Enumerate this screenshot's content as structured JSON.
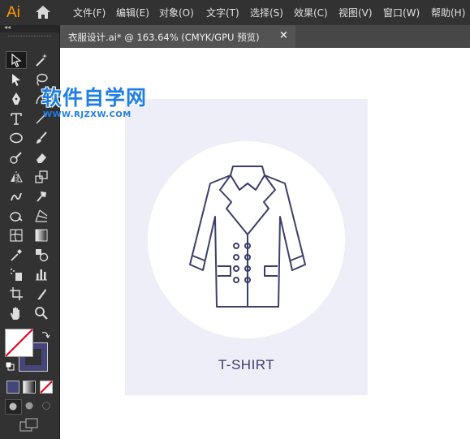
{
  "app": {
    "logo": "Ai"
  },
  "menu": {
    "items": [
      "文件(F)",
      "编辑(E)",
      "对象(O)",
      "文字(T)",
      "选择(S)",
      "效果(C)",
      "视图(V)",
      "窗口(W)",
      "帮助(H)"
    ]
  },
  "tab": {
    "title": "衣服设计.ai* @ 163.64% (CMYK/GPU 预览)",
    "close": "×"
  },
  "toolbar": {
    "collapse": "◂◂"
  },
  "tools": [
    "selection-tool",
    "magic-wand-tool",
    "direct-selection-tool",
    "lasso-tool",
    "pen-tool",
    "curvature-tool",
    "type-tool",
    "line-segment-tool",
    "ellipse-tool",
    "paintbrush-tool",
    "shaper-tool",
    "eraser-tool",
    "reflect-tool",
    "scale-tool",
    "warp-tool",
    "free-transform-tool",
    "shape-builder-tool",
    "perspective-grid-tool",
    "mesh-tool",
    "gradient-tool",
    "eyedropper-tool",
    "blend-tool",
    "symbol-sprayer-tool",
    "column-graph-tool",
    "artboard-tool",
    "slice-tool",
    "hand-tool",
    "zoom-tool"
  ],
  "artwork": {
    "label": "T-SHIRT"
  },
  "watermark": {
    "title": "软件自学网",
    "url": "WWW.RJZXW.COM"
  },
  "colors": {
    "accent": "#ff9a00",
    "artboard": "#eeeef8",
    "stroke": "#3e3d6a",
    "watermark": "#1e7ee6"
  }
}
